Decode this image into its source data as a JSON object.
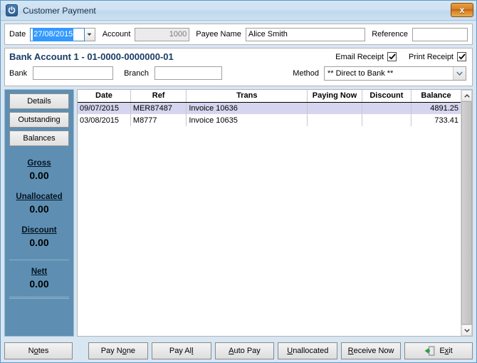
{
  "window": {
    "title": "Customer Payment",
    "app_icon": "power-icon",
    "close_label": "x"
  },
  "top_row": {
    "date_label": "Date",
    "date_value": "27/08/2015",
    "date_dropdown_icon": "chevron-down-icon",
    "account_label": "Account",
    "account_value": "1000",
    "payee_label": "Payee Name",
    "payee_value": "Alice Smith",
    "reference_label": "Reference",
    "reference_value": "",
    "reference_placeholder": ""
  },
  "bank_section": {
    "title": "Bank Account 1 - 01-0000-0000000-01",
    "bank_label": "Bank",
    "bank_value": "",
    "branch_label": "Branch",
    "branch_value": "",
    "method_label": "Method",
    "method_value": "** Direct to Bank **",
    "method_arrow_icon": "chevron-down-icon",
    "email_receipt_label": "Email Receipt",
    "email_receipt_checked": true,
    "print_receipt_label": "Print Receipt",
    "print_receipt_checked": true
  },
  "side_panel": {
    "accent_color": "#5e8fb3",
    "buttons": [
      {
        "label": "Details"
      },
      {
        "label": "Outstanding"
      },
      {
        "label": "Balances"
      }
    ],
    "totals": [
      {
        "label": "Gross",
        "value": "0.00"
      },
      {
        "label": "Unallocated",
        "value": "0.00"
      },
      {
        "label": "Discount",
        "value": "0.00"
      },
      {
        "label": "Nett",
        "value": "0.00"
      }
    ]
  },
  "grid": {
    "columns": [
      "Date",
      "Ref",
      "Trans",
      "Paying Now",
      "Discount",
      "Balance"
    ],
    "rows": [
      {
        "date": "09/07/2015",
        "ref": "MER87487",
        "trans": "Invoice 10636",
        "paying_now": "",
        "discount": "",
        "balance": "4891.25",
        "selected": true
      },
      {
        "date": "03/08/2015",
        "ref": "M8777",
        "trans": "Invoice 10635",
        "paying_now": "",
        "discount": "",
        "balance": "733.41",
        "selected": false
      }
    ],
    "selected_row_color": "#d5d5f0",
    "scroll_up_icon": "chevron-up-icon",
    "scroll_down_icon": "chevron-down-icon"
  },
  "footer": {
    "notes": {
      "pre": "N",
      "key": "o",
      "post": "tes"
    },
    "pay_none": {
      "pre": "Pay N",
      "key": "o",
      "post": "ne"
    },
    "pay_all": {
      "pre": "Pay Al",
      "key": "l",
      "post": ""
    },
    "auto_pay": {
      "pre": "",
      "key": "A",
      "post": "uto Pay"
    },
    "unallocated": {
      "pre": "",
      "key": "U",
      "post": "nallocated"
    },
    "receive_now": {
      "pre": "",
      "key": "R",
      "post": "eceive Now"
    },
    "exit": {
      "pre": "E",
      "key": "x",
      "post": "it"
    },
    "exit_icon": "exit-door-icon"
  }
}
